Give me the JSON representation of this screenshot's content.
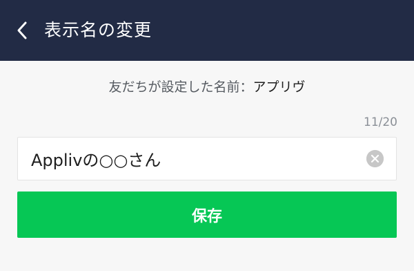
{
  "header": {
    "title": "表示名の変更",
    "back_icon": "chevron-left-icon",
    "background": "#222b45"
  },
  "friend_set_name": {
    "label": "友だちが設定した名前：",
    "value": "アプリヴ"
  },
  "name_input": {
    "value": "Applivの○○さん",
    "counter": "11/20",
    "clear_icon": "clear-circle-icon"
  },
  "save_button": {
    "label": "保存",
    "color": "#06c755"
  }
}
